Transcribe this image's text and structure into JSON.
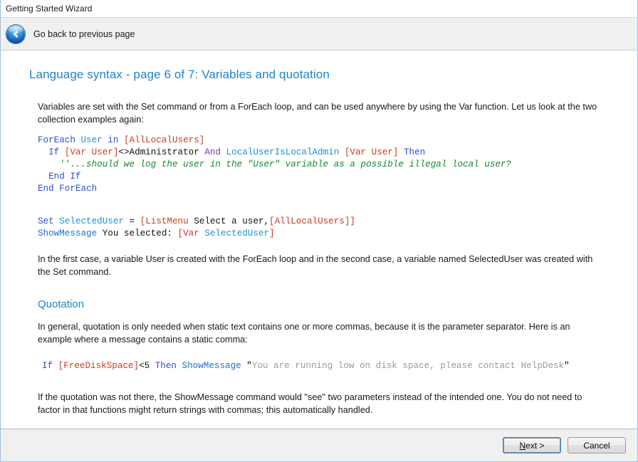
{
  "window": {
    "title": "Getting Started Wizard"
  },
  "navbar": {
    "back_icon": "back-arrow-circle-icon",
    "back_label": "Go back to previous page"
  },
  "content": {
    "page_title": "Language syntax - page 6 of 7: Variables and quotation",
    "intro_paragraph": "Variables are set with the Set command or from a ForEach loop, and can be used anywhere by using the Var function. Let us look at the two collection examples again:",
    "code_block_1": [
      [
        {
          "t": "ForEach",
          "c": "kw"
        },
        {
          "t": " ",
          "c": "plain"
        },
        {
          "t": "User",
          "c": "var"
        },
        {
          "t": " ",
          "c": "plain"
        },
        {
          "t": "in",
          "c": "kw"
        },
        {
          "t": " ",
          "c": "plain"
        },
        {
          "t": "[AllLocalUsers]",
          "c": "br"
        }
      ],
      [
        {
          "t": "  ",
          "c": "plain"
        },
        {
          "t": "If",
          "c": "kw"
        },
        {
          "t": " ",
          "c": "plain"
        },
        {
          "t": "[Var User]",
          "c": "br"
        },
        {
          "t": "<>Administrator",
          "c": "plain"
        },
        {
          "t": " ",
          "c": "plain"
        },
        {
          "t": "And",
          "c": "op"
        },
        {
          "t": " ",
          "c": "plain"
        },
        {
          "t": "LocalUserIsLocalAdmin",
          "c": "var"
        },
        {
          "t": " ",
          "c": "plain"
        },
        {
          "t": "[Var User]",
          "c": "br"
        },
        {
          "t": " ",
          "c": "plain"
        },
        {
          "t": "Then",
          "c": "kw"
        }
      ],
      [
        {
          "t": "    ''...should we log the user in the \"User\" variable as a possible illegal local user?",
          "c": "cmt"
        }
      ],
      [
        {
          "t": "  ",
          "c": "plain"
        },
        {
          "t": "End If",
          "c": "kw"
        }
      ],
      [
        {
          "t": "End ForEach",
          "c": "kw"
        }
      ]
    ],
    "code_block_2": [
      [
        {
          "t": "Set",
          "c": "kw"
        },
        {
          "t": " ",
          "c": "plain"
        },
        {
          "t": "SelectedUser",
          "c": "var"
        },
        {
          "t": " = ",
          "c": "plain"
        },
        {
          "t": "[ListMenu",
          "c": "br"
        },
        {
          "t": " Select a user,",
          "c": "plain"
        },
        {
          "t": "[AllLocalUsers]]",
          "c": "br"
        }
      ],
      [
        {
          "t": "ShowMessage",
          "c": "fn"
        },
        {
          "t": " You selected: ",
          "c": "plain"
        },
        {
          "t": "[Var ",
          "c": "br"
        },
        {
          "t": "SelectedUser",
          "c": "var"
        },
        {
          "t": "]",
          "c": "br"
        }
      ]
    ],
    "after_code_paragraph": "In the first case, a variable User is created with the ForEach loop and in the second case, a variable named SelectedUser was created with the Set command.",
    "section_heading": "Quotation",
    "quotation_paragraph": "In general, quotation is only needed when static text contains one or more commas, because it is the parameter separator. Here is an example where a message contains a static comma:",
    "code_block_3": [
      [
        {
          "t": "If",
          "c": "kw"
        },
        {
          "t": " ",
          "c": "plain"
        },
        {
          "t": "[FreeDiskSpace]",
          "c": "br"
        },
        {
          "t": "<5",
          "c": "plain"
        },
        {
          "t": " ",
          "c": "plain"
        },
        {
          "t": "Then",
          "c": "kw"
        },
        {
          "t": " ",
          "c": "plain"
        },
        {
          "t": "ShowMessage",
          "c": "fn"
        },
        {
          "t": " ",
          "c": "plain"
        },
        {
          "t": "\"",
          "c": "plain"
        },
        {
          "t": "You are running low on disk space, please contact HelpDesk",
          "c": "str"
        },
        {
          "t": "\"",
          "c": "plain"
        }
      ]
    ],
    "closing_paragraph": "If the quotation was not there, the ShowMessage command would \"see\" two parameters instead of the intended one. You do not need to factor in that functions might return strings with commas; this automatically handled."
  },
  "footer": {
    "next_label_before": "",
    "next_accel": "N",
    "next_label_after": "ext >",
    "cancel_label": "Cancel"
  },
  "colors": {
    "accent_blue": "#1f84c8",
    "keyword": "#2b4fcf",
    "variable": "#1f8fd0",
    "bracket": "#cc3b1f",
    "operator": "#8a2fa8",
    "comment": "#138a2e",
    "string": "#9a9a9a",
    "toolbar_bg": "#f0f0f0",
    "window_border": "#a3bcd4"
  }
}
